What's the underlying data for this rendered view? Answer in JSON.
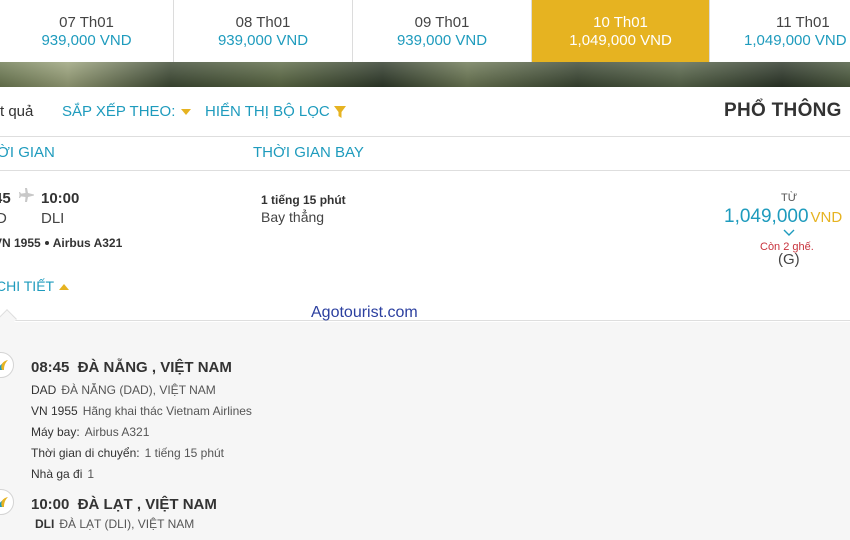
{
  "date_tabs": [
    {
      "date": "07 Th01",
      "price": "939,000 VND"
    },
    {
      "date": "08 Th01",
      "price": "939,000 VND"
    },
    {
      "date": "09 Th01",
      "price": "939,000 VND"
    },
    {
      "date": "10 Th01",
      "price": "1,049,000 VND"
    },
    {
      "date": "11 Th01",
      "price": "1,049,000 VND"
    }
  ],
  "toolbar": {
    "results_label": "t quả",
    "sort_label": "SẮP XẾP THEO:",
    "filter_label": "HIỂN THỊ BỘ LỌC",
    "cabin_label": "PHỔ THÔNG"
  },
  "columns": {
    "time": "ỜI GIAN",
    "duration": "THỜI GIAN BAY"
  },
  "flight": {
    "dep_time": "45",
    "arr_time": "10:00",
    "dep_code": "D",
    "arr_code": "DLI",
    "flight_no": "VN 1955",
    "aircraft": "Airbus A321",
    "duration": "1 tiếng 15 phút",
    "stops": "Bay thẳng",
    "from_label": "TỪ",
    "price": "1,049,000",
    "currency": "VND",
    "seats_left": "Còn 2 ghế.",
    "fare_class": "(G)",
    "detail_link": "CHI TIẾT"
  },
  "watermark": "Agotourist.com",
  "segments": [
    {
      "title_time": "08:45",
      "title_place": "ĐÀ NẴNG , VIỆT NAM",
      "airport_code": "DAD",
      "airport_name": "ĐÀ NẴNG (DAD), VIỆT NAM",
      "flight_no": "VN 1955",
      "operator": "Hãng khai thác Vietnam Airlines",
      "aircraft_label": "Máy bay:",
      "aircraft": "Airbus A321",
      "travel_label": "Thời gian di chuyển:",
      "travel_time": "1 tiếng 15 phút",
      "terminal_label": "Nhà ga đi",
      "terminal": "1"
    },
    {
      "title_time": "10:00",
      "title_place": "ĐÀ LẠT , VIỆT NAM",
      "airport_code": "DLI",
      "airport_name": "ĐÀ LẠT (DLI), VIỆT NAM"
    }
  ],
  "colors": {
    "accent_blue": "#1e9bbd",
    "accent_gold": "#e6b321",
    "alert_red": "#c8323c"
  }
}
